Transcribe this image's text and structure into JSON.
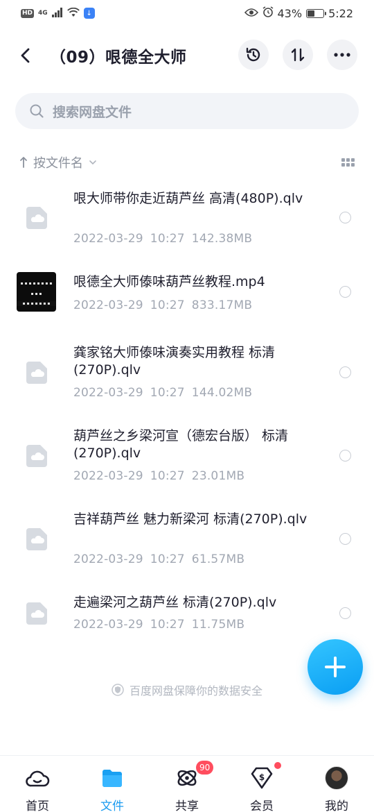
{
  "status_bar": {
    "hd": "HD",
    "network": "4G",
    "battery_percent": "43%",
    "battery_level": 0.43,
    "time": "5:22"
  },
  "header": {
    "title": "（09）哏德全大师"
  },
  "search": {
    "placeholder": "搜索网盘文件"
  },
  "sort": {
    "label": "按文件名"
  },
  "files": [
    {
      "name": "哏大师带你走近葫芦丝 高清(480P).qlv",
      "date": "2022-03-29",
      "time": "10:27",
      "size": "142.38MB",
      "type": "doc"
    },
    {
      "name": "哏德全大师傣味葫芦丝教程.mp4",
      "date": "2022-03-29",
      "time": "10:27",
      "size": "833.17MB",
      "type": "video"
    },
    {
      "name": "龚家铭大师傣味演奏实用教程 标清(270P).qlv",
      "date": "2022-03-29",
      "time": "10:27",
      "size": "144.02MB",
      "type": "doc"
    },
    {
      "name": "葫芦丝之乡梁河宣（德宏台版） 标清(270P).qlv",
      "date": "2022-03-29",
      "time": "10:27",
      "size": "23.01MB",
      "type": "doc"
    },
    {
      "name": "吉祥葫芦丝 魅力新梁河 标清(270P).qlv",
      "date": "2022-03-29",
      "time": "10:27",
      "size": "61.57MB",
      "type": "doc"
    },
    {
      "name": "走遍梁河之葫芦丝 标清(270P).qlv",
      "date": "2022-03-29",
      "time": "10:27",
      "size": "11.75MB",
      "type": "doc"
    }
  ],
  "footer_note": "百度网盘保障你的数据安全",
  "nav": {
    "home": "首页",
    "files": "文件",
    "share": "共享",
    "share_badge": "90",
    "vip": "会员",
    "mine": "我的"
  },
  "colors": {
    "accent": "#1a9bf0",
    "badge": "#ff4d5e"
  }
}
